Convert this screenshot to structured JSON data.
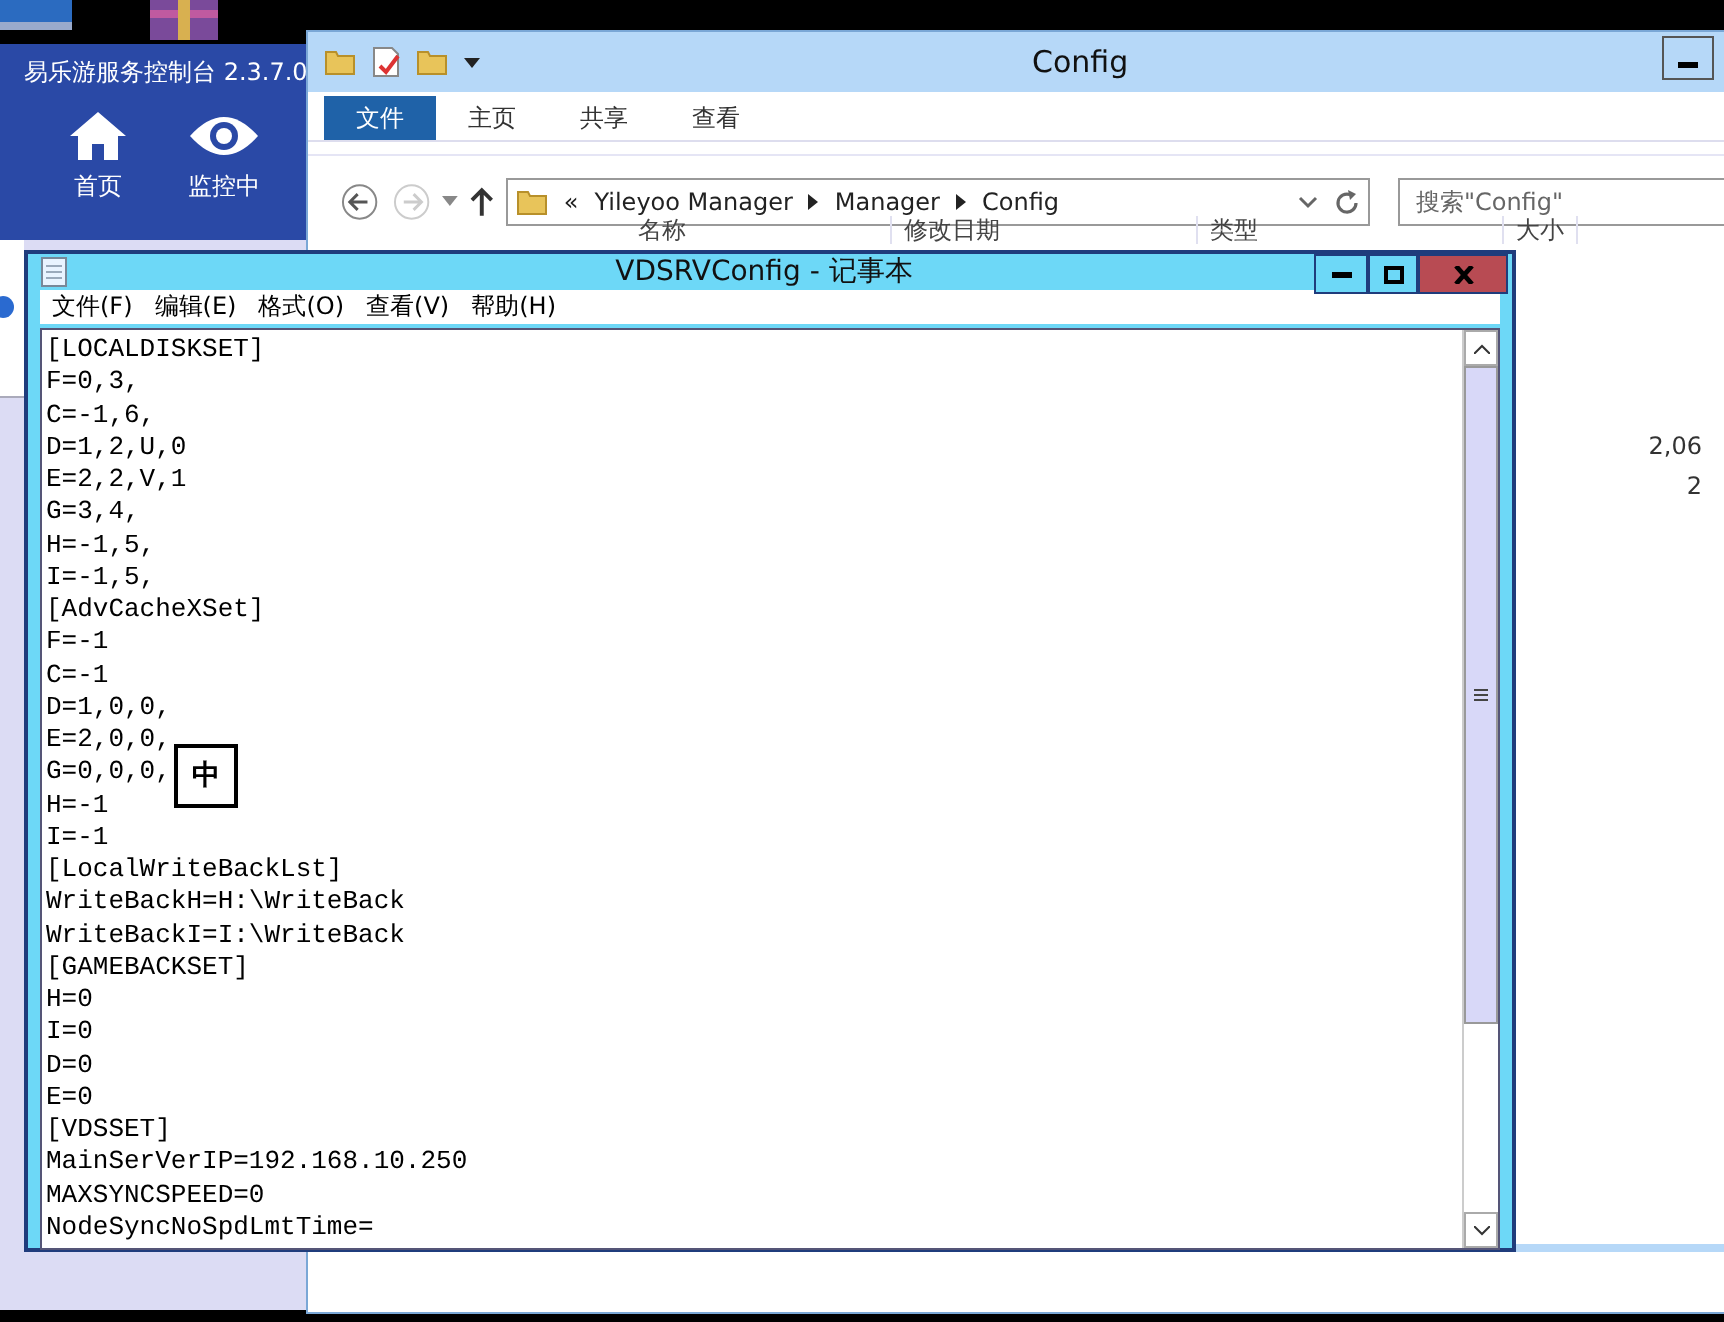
{
  "launcher": {
    "title": "易乐游服务控制台 2.3.7.0",
    "nav": [
      {
        "label": "首页",
        "kind": "home"
      },
      {
        "label": "监控中",
        "kind": "monitor"
      }
    ]
  },
  "explorer": {
    "title": "Config",
    "ribbon_tabs": [
      {
        "label": "文件",
        "selected": true
      },
      {
        "label": "主页",
        "selected": false
      },
      {
        "label": "共享",
        "selected": false
      },
      {
        "label": "查看",
        "selected": false
      }
    ],
    "address": {
      "overflow": "«",
      "segments": [
        "Yileyoo Manager",
        "Manager",
        "Config"
      ]
    },
    "search": {
      "placeholder": "搜索\"Config\""
    },
    "columns": [
      "名称",
      "修改日期",
      "类型",
      "大小"
    ],
    "sizes": [
      "2,06",
      "2"
    ]
  },
  "notepad": {
    "title": "VDSRVConfig - 记事本",
    "menu": [
      "文件(F)",
      "编辑(E)",
      "格式(O)",
      "查看(V)",
      "帮助(H)"
    ],
    "lines": [
      "[LOCALDISKSET]",
      "F=0,3,",
      "C=-1,6,",
      "D=1,2,U,0",
      "E=2,2,V,1",
      "G=3,4,",
      "H=-1,5,",
      "I=-1,5,",
      "[AdvCacheXSet]",
      "F=-1",
      "C=-1",
      "D=1,0,0,",
      "E=2,0,0,",
      "G=0,0,0,",
      "H=-1",
      "I=-1",
      "[LocalWriteBackLst]",
      "WriteBackH=H:\\WriteBack",
      "WriteBackI=I:\\WriteBack",
      "[GAMEBACKSET]",
      "H=0",
      "I=0",
      "D=0",
      "E=0",
      "[VDSSET]",
      "MainSerVerIP=192.168.10.250",
      "MAXSYNCSPEED=0",
      "NodeSyncNoSpdLmtTime="
    ],
    "ime": "中"
  }
}
